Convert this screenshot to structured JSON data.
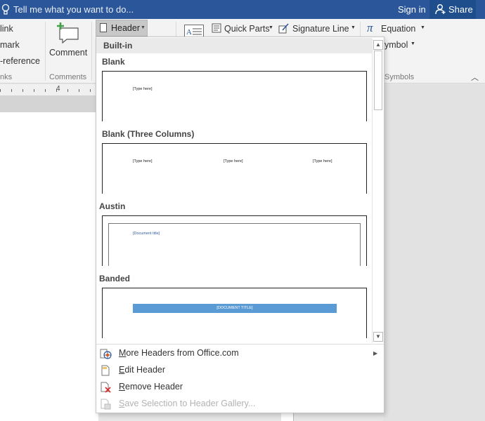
{
  "titlebar": {
    "tell_me": "Tell me what you want to do...",
    "sign_in": "Sign in",
    "share": "Share",
    "bg_color": "#2b579a"
  },
  "ribbon": {
    "links_items": [
      "link",
      "mark",
      "-reference"
    ],
    "links_group": "nks",
    "comment_label": "Comment",
    "comments_group": "Comments",
    "header_label": "Header",
    "quick_parts": "Quick Parts",
    "signature_line": "Signature Line",
    "equation": "Equation",
    "symbol": "ymbol",
    "symbols_group": "Symbols"
  },
  "ruler": {
    "number": "4"
  },
  "dropdown": {
    "section": "Built-in",
    "gallery": [
      {
        "name": "Blank",
        "placeholders": [
          "[Type here]"
        ]
      },
      {
        "name": "Blank (Three Columns)",
        "placeholders": [
          "[Type here]",
          "[Type here]",
          "[Type here]"
        ]
      },
      {
        "name": "Austin",
        "placeholders": [
          "[Document title]"
        ]
      },
      {
        "name": "Banded",
        "placeholders": [
          "[DOCUMENT TITLE]"
        ]
      }
    ],
    "menu": [
      {
        "hotkey": "M",
        "rest": "ore Headers from Office.com",
        "icon": "office-web-icon",
        "disabled": false,
        "submenu": true
      },
      {
        "hotkey": "E",
        "rest": "dit Header",
        "icon": "edit-header-icon",
        "disabled": false,
        "submenu": false
      },
      {
        "hotkey": "R",
        "rest": "emove Header",
        "icon": "remove-header-icon",
        "disabled": false,
        "submenu": false
      },
      {
        "hotkey": "S",
        "rest": "ave Selection to Header Gallery...",
        "icon": "save-gallery-icon",
        "disabled": true,
        "submenu": false
      }
    ]
  }
}
